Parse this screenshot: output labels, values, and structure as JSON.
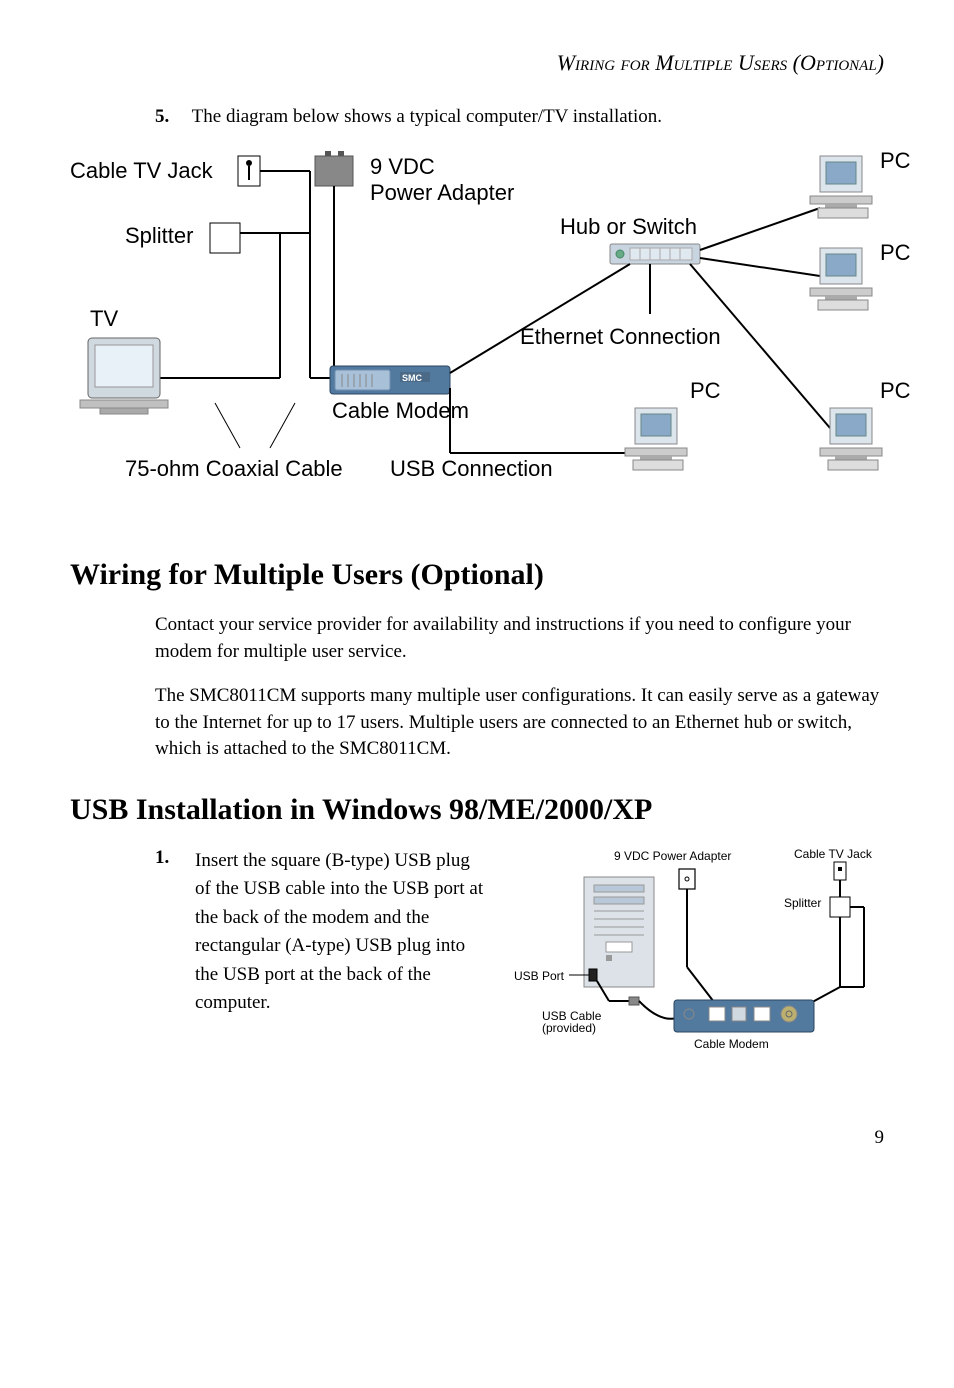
{
  "running_header": "Wiring for Multiple Users (Optional)",
  "step5": {
    "num": "5.",
    "text": "The diagram below shows a typical computer/TV installation."
  },
  "diagram1": {
    "cable_tv_jack": "Cable TV Jack",
    "nine_vdc": "9 VDC",
    "power_adapter": "Power Adapter",
    "hub_or_switch": "Hub or Switch",
    "splitter": "Splitter",
    "tv": "TV",
    "ethernet": "Ethernet Connection",
    "cable_modem": "Cable Modem",
    "coax": "75-ohm Coaxial Cable",
    "usb_conn": "USB Connection",
    "pc": "PC"
  },
  "heading_wiring": "Wiring for Multiple Users (Optional)",
  "para1": "Contact your service provider for availability and instructions if you need to configure your modem for multiple user service.",
  "para2": "The SMC8011CM supports many multiple user configurations. It can easily serve as a gateway to the Internet for up to 17 users.  Multiple users are connected to an Ethernet hub or switch, which is attached to the SMC8011CM.",
  "heading_usb": "USB Installation in Windows 98/ME/2000/XP",
  "step1": {
    "num": "1.",
    "text": "Insert the square (B-type) USB plug of the USB cable into the USB port at the back of the modem and the rectangular (A-type) USB plug into the USB port at the back of the computer."
  },
  "diagram2": {
    "nine_vdc": "9 VDC Power Adapter",
    "cable_tv_jack": "Cable TV Jack",
    "splitter": "Splitter",
    "usb_port": "USB Port",
    "usb_cable": "USB Cable",
    "provided": "(provided)",
    "cable_modem": "Cable Modem"
  },
  "page_number": "9"
}
